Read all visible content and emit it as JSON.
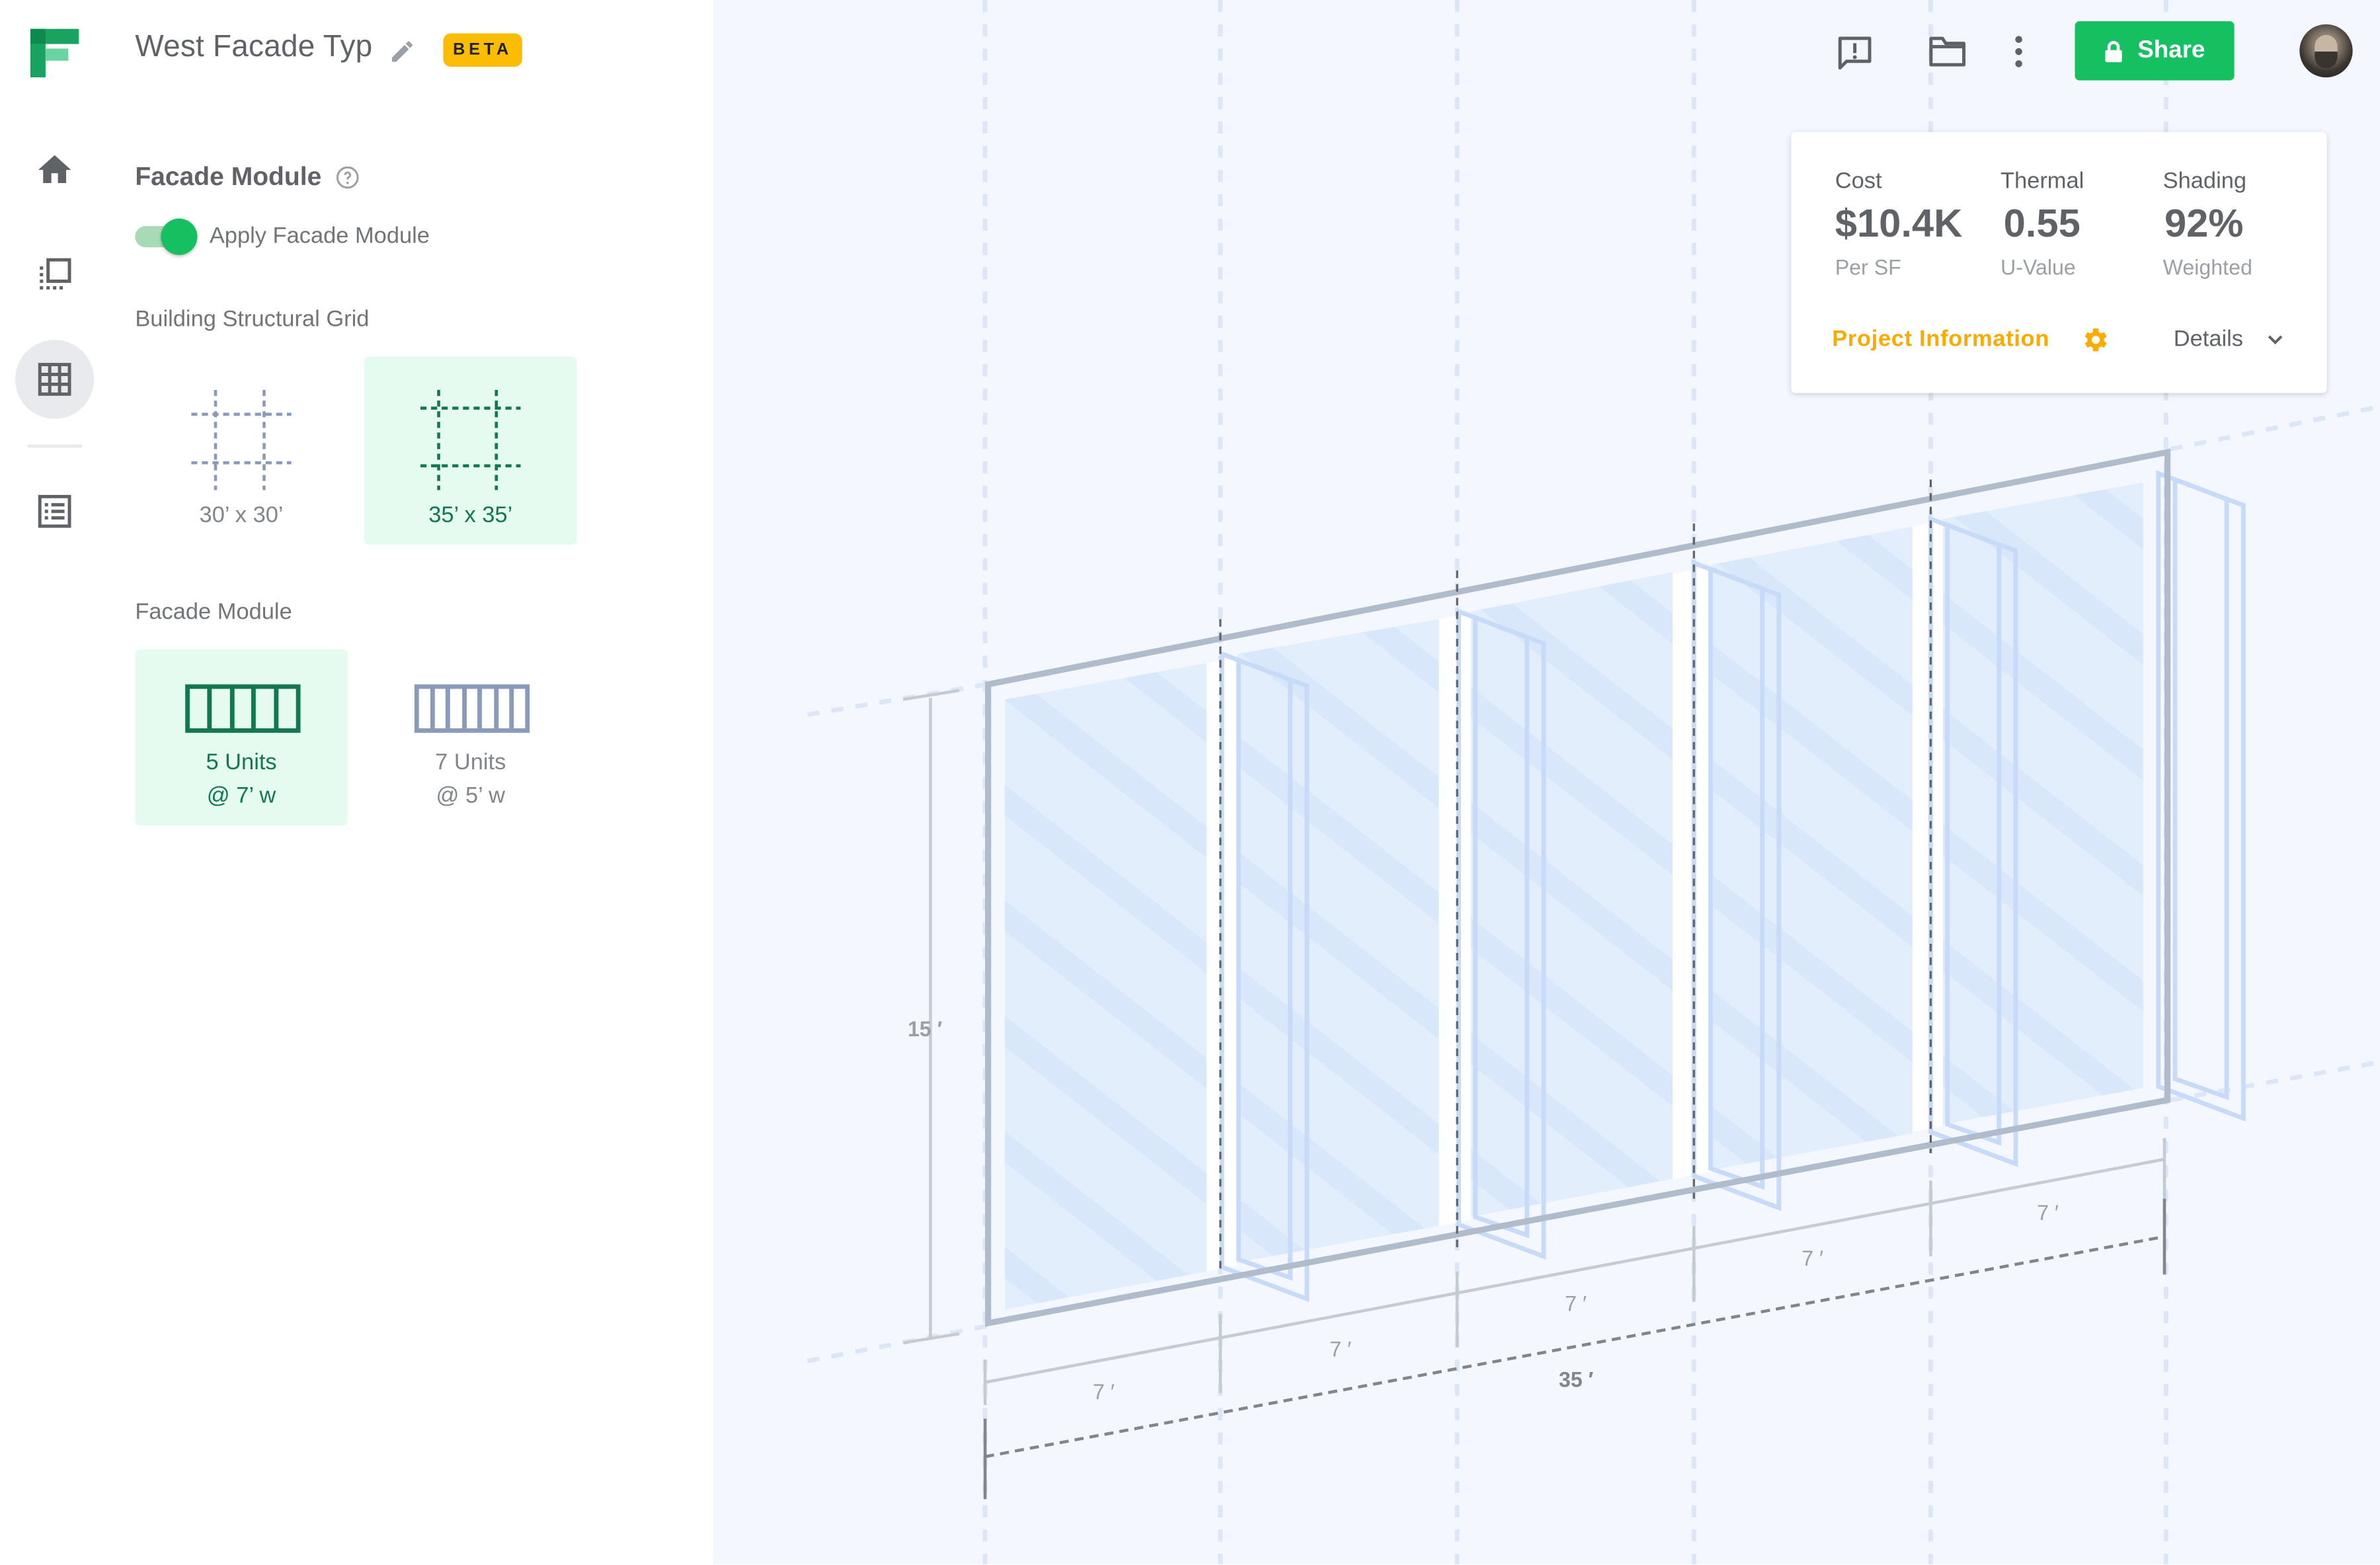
{
  "app": {
    "document_title": "West Facade Typ",
    "beta_badge": "BETA"
  },
  "rail": {
    "items": [
      "home",
      "pages",
      "grid",
      "list"
    ],
    "active": "grid"
  },
  "panel": {
    "section_title": "Facade Module",
    "toggle_label": "Apply Facade Module",
    "toggle_on": true,
    "grid_heading": "Building Structural Grid",
    "grid_options": [
      {
        "label": "30’ x 30’",
        "selected": false
      },
      {
        "label": "35’ x 35’",
        "selected": true
      }
    ],
    "module_heading": "Facade Module",
    "module_options": [
      {
        "line1": "5 Units",
        "line2": "@ 7’ w",
        "selected": true
      },
      {
        "line1": "7 Units",
        "line2": "@ 5’ w",
        "selected": false
      }
    ]
  },
  "toolbar": {
    "share_label": "Share"
  },
  "metrics": {
    "cost": {
      "label": "Cost",
      "value": "$10.4K",
      "unit": "Per SF"
    },
    "thermal": {
      "label": "Thermal",
      "value": "0.55",
      "unit": "U-Value"
    },
    "shading": {
      "label": "Shading",
      "value": "92%",
      "unit": "Weighted"
    },
    "project_info_label": "Project Information",
    "details_label": "Details"
  },
  "drawing": {
    "height_label": "15 ′",
    "unit_labels": [
      "7 ′",
      "7 ′",
      "7 ′",
      "7 ′",
      "7 ′"
    ],
    "total_label": "35 ′"
  },
  "colors": {
    "accent_green": "#16c060",
    "selected_bg": "#e6fbef",
    "selected_text": "#137752",
    "beta_yellow": "#fbbc04",
    "project_info": "#f9ab00",
    "canvas_bg": "#f4f8fe"
  }
}
